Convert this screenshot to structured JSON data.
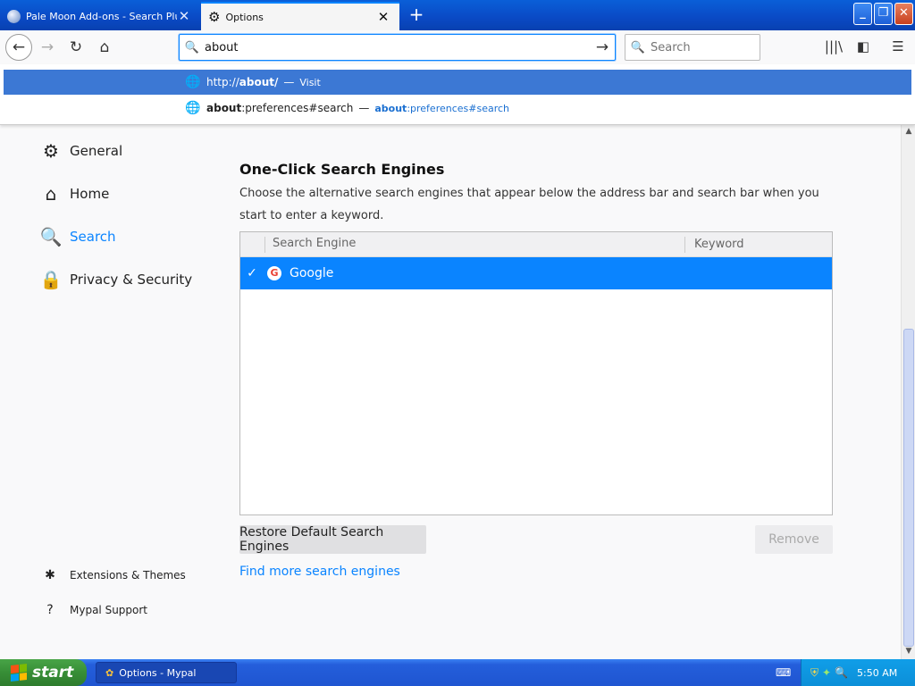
{
  "tabs": [
    {
      "title": "Pale Moon Add-ons - Search Plugins"
    },
    {
      "title": "Options"
    }
  ],
  "icons": {
    "close": "✕",
    "new_tab": "+",
    "minimize": "_",
    "restore": "❐",
    "window_close": "✕",
    "back": "←",
    "forward": "→",
    "reload": "↻",
    "home": "⌂",
    "search": "🔍",
    "go": "→",
    "library": "|||\\",
    "sidebar": "◧",
    "menu": "☰",
    "globe": "🌐",
    "gear": "⚙",
    "house": "⌂",
    "lock": "🔒",
    "puzzle": "✱",
    "help": "?",
    "check": "✓",
    "google": "G",
    "scroll_up": "▲",
    "scroll_down": "▼",
    "taskitem": "✿",
    "keyboard": "⌨",
    "tray": [
      "⛨",
      "✦",
      "🔍"
    ]
  },
  "navbar": {
    "url_value": "about",
    "search_placeholder": "Search"
  },
  "url_dropdown": {
    "row1": {
      "prefix": "http://",
      "bold": "about/",
      "dash": "—",
      "action": "Visit"
    },
    "row2": {
      "bold": "about",
      "rest": ":preferences#search",
      "dash": "—",
      "action_bold": "about",
      "action_rest": ":preferences#search"
    }
  },
  "sidebar": {
    "categories": [
      {
        "label": "General"
      },
      {
        "label": "Home"
      },
      {
        "label": "Search"
      },
      {
        "label": "Privacy & Security"
      }
    ],
    "footer": [
      {
        "label": "Extensions & Themes"
      },
      {
        "label": "Mypal Support"
      }
    ]
  },
  "main": {
    "heading": "One-Click Search Engines",
    "description": "Choose the alternative search engines that appear below the address bar and search bar when you start to enter a keyword.",
    "columns": [
      "Search Engine",
      "Keyword"
    ],
    "engines": [
      {
        "name": "Google",
        "keyword": "",
        "checked": true
      }
    ],
    "restore_label": "Restore Default Search Engines",
    "remove_label": "Remove",
    "find_more_label": "Find more search engines"
  },
  "taskbar": {
    "start_label": "start",
    "window_label": "Options - Mypal",
    "clock": "5:50 AM"
  },
  "colors": {
    "accent": "#0a84ff",
    "selected_row": "#0a84ff",
    "dropdown_selected": "#3c78d4",
    "taskbar": "#245edb",
    "start_green": "#378e36"
  }
}
